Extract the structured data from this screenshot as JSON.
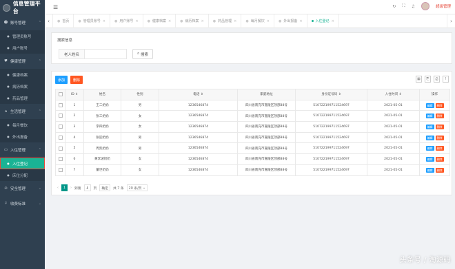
{
  "brand": {
    "title": "信息管理平台"
  },
  "sidebar": {
    "groups": [
      {
        "label": "账号管理",
        "icon": "person-icon",
        "items": [
          {
            "label": "管理员账号"
          },
          {
            "label": "用户账号"
          }
        ]
      },
      {
        "label": "健康管理",
        "icon": "heart-icon",
        "items": [
          {
            "label": "健康档案"
          },
          {
            "label": "病历档案"
          },
          {
            "label": "药品管理"
          }
        ]
      },
      {
        "label": "生活管理",
        "icon": "home-icon",
        "items": [
          {
            "label": "每月餐饮"
          },
          {
            "label": "外出报备"
          }
        ]
      },
      {
        "label": "入住管理",
        "icon": "bed-icon",
        "items": [
          {
            "label": "入住登记",
            "active": true
          },
          {
            "label": "床位分配"
          }
        ]
      },
      {
        "label": "安全管理",
        "icon": "shield-icon",
        "items": []
      },
      {
        "label": "收费标准",
        "icon": "flag-icon",
        "items": []
      }
    ]
  },
  "topbar": {
    "username": "超级管理",
    "icons": [
      "refresh-icon",
      "fullscreen-icon",
      "bell-icon"
    ]
  },
  "tabs": [
    {
      "label": "首页",
      "active": false
    },
    {
      "label": "管理员账号",
      "active": false
    },
    {
      "label": "用户账号",
      "active": false
    },
    {
      "label": "健康档案",
      "active": false
    },
    {
      "label": "病历档案",
      "active": false
    },
    {
      "label": "药品管理",
      "active": false
    },
    {
      "label": "每月餐饮",
      "active": false
    },
    {
      "label": "外出报备",
      "active": false
    },
    {
      "label": "入住登记",
      "active": true
    }
  ],
  "search": {
    "title": "搜索信息",
    "name_label": "老人姓名",
    "name_value": "",
    "button": "搜索"
  },
  "table": {
    "add_label": "添加",
    "delete_label": "删除",
    "columns": [
      "ID ⇕",
      "姓名",
      "性别",
      "电话 ⇕",
      "家庭地址",
      "身份证号码 ⇕",
      "入住时间 ⇕",
      "操作"
    ],
    "rows": [
      [
        "1",
        "王二奶奶",
        "男",
        "1236546874",
        "四川省南充市嘉陵区顶部88号",
        "510722199711524697",
        "2021-05-01"
      ],
      [
        "2",
        "张三奶奶",
        "女",
        "1236546874",
        "四川省南充市嘉陵区顶部88号",
        "510722199711524697",
        "2021-05-01"
      ],
      [
        "3",
        "李四奶奶",
        "女",
        "1236546874",
        "四川省南充市嘉陵区顶部88号",
        "510722199711524697",
        "2021-05-01"
      ],
      [
        "4",
        "张迎奶奶",
        "男",
        "1236546874",
        "四川省南充市嘉陵区顶部88号",
        "510722199711524697",
        "2021-05-01"
      ],
      [
        "5",
        "周凯奶奶",
        "男",
        "1236546874",
        "四川省南充市嘉陵区顶部88号",
        "510722199711524697",
        "2021-05-01"
      ],
      [
        "6",
        "黄李波奶奶",
        "女",
        "1236546874",
        "四川省南充市嘉陵区顶部88号",
        "510722199711524697",
        "2021-05-01"
      ],
      [
        "7",
        "董世奶奶",
        "女",
        "1236546874",
        "四川省南充市嘉陵区顶部88号",
        "510722199711524697",
        "2021-05-01"
      ]
    ],
    "edit_label": "编辑",
    "del_label": "删除"
  },
  "pager": {
    "current": "1",
    "goto_label": "到第",
    "page_value": "1",
    "page_unit": "页",
    "confirm": "确定",
    "total": "共 7 条",
    "page_size": "20 条/页"
  },
  "watermark": "头条号 / 淘源码"
}
